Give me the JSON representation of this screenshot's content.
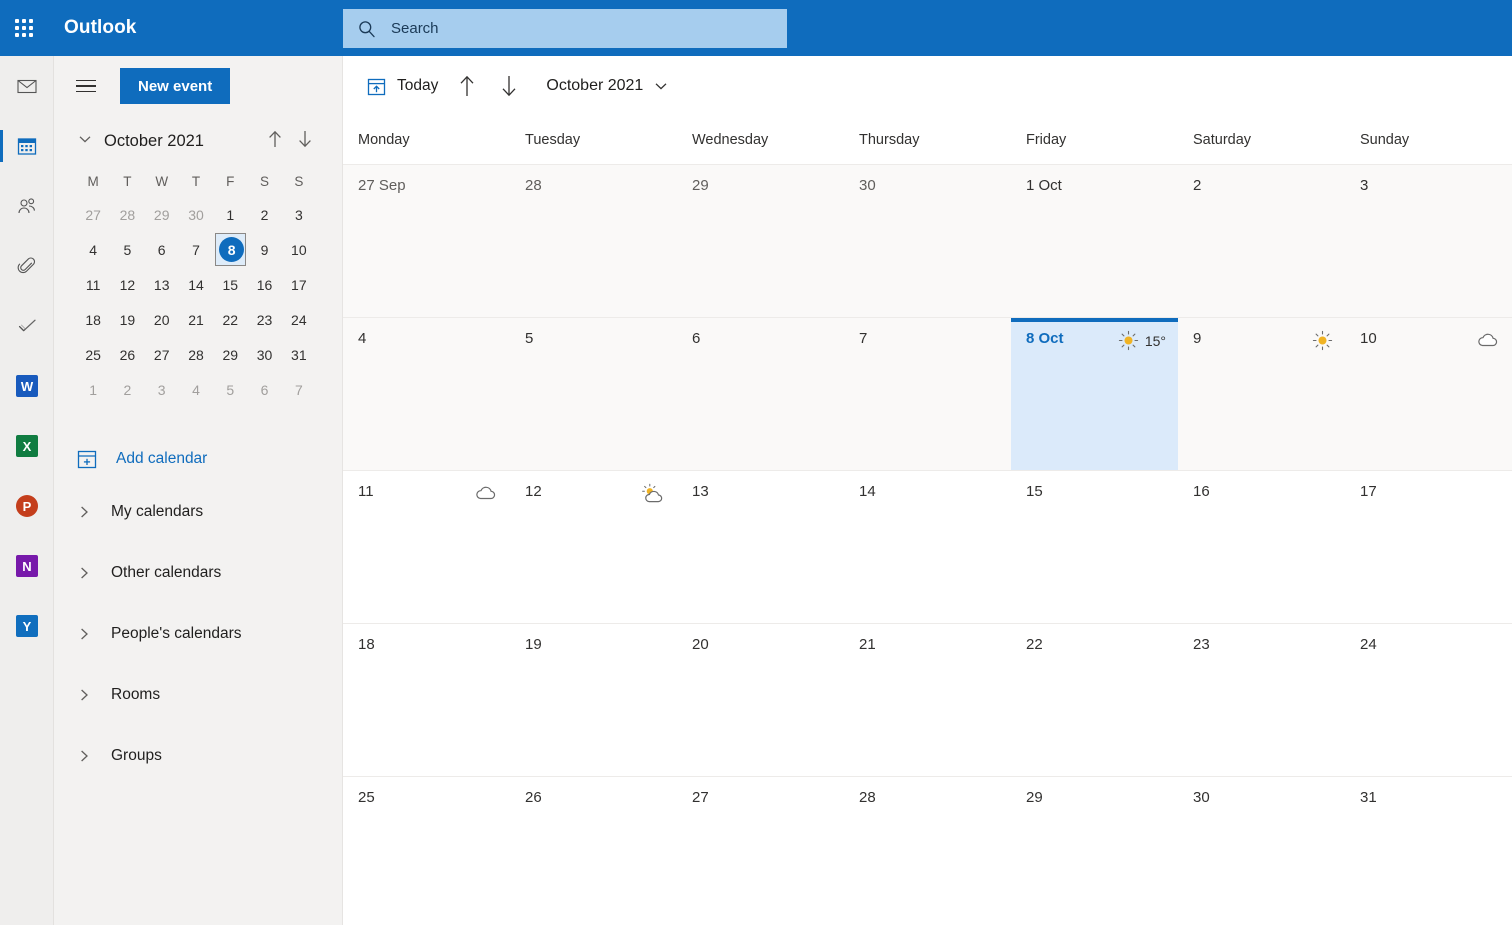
{
  "topbar": {
    "waffle_icon": "app-launcher-icon",
    "brand": "Outlook",
    "search": {
      "icon": "search-icon",
      "placeholder": "Search",
      "value": ""
    }
  },
  "rail": {
    "items": [
      {
        "name": "mail",
        "icon": "mail-icon",
        "label": "Mail",
        "selected": false
      },
      {
        "name": "calendar",
        "icon": "calendar-icon",
        "label": "Calendar",
        "selected": true
      },
      {
        "name": "people",
        "icon": "people-icon",
        "label": "People",
        "selected": false
      },
      {
        "name": "files",
        "icon": "paperclip-icon",
        "label": "Files",
        "selected": false
      },
      {
        "name": "todo",
        "icon": "checkmark-icon",
        "label": "To Do",
        "selected": false
      },
      {
        "name": "word",
        "icon": "word-icon",
        "label": "Word",
        "glyph": "W",
        "color": "#185abd",
        "selected": false
      },
      {
        "name": "excel",
        "icon": "excel-icon",
        "label": "Excel",
        "glyph": "X",
        "color": "#107c41",
        "selected": false
      },
      {
        "name": "powerpoint",
        "icon": "powerpoint-icon",
        "label": "PowerPoint",
        "glyph": "P",
        "color": "#c43e1c",
        "selected": false
      },
      {
        "name": "onenote",
        "icon": "onenote-icon",
        "label": "OneNote",
        "glyph": "N",
        "color": "#7719aa",
        "selected": false
      },
      {
        "name": "yammer",
        "icon": "yammer-icon",
        "label": "Yammer",
        "glyph": "Y",
        "color": "#106ebe",
        "selected": false
      }
    ]
  },
  "leftpane": {
    "hamburger_icon": "hamburger-menu-icon",
    "new_event_label": "New event",
    "minicalendar": {
      "collapse_icon": "chevron-down-icon",
      "title": "October 2021",
      "prev_icon": "arrow-up-icon",
      "next_icon": "arrow-down-icon",
      "weekday_initials": [
        "M",
        "T",
        "W",
        "T",
        "F",
        "S",
        "S"
      ],
      "weeks": [
        [
          {
            "d": "27",
            "other": true
          },
          {
            "d": "28",
            "other": true
          },
          {
            "d": "29",
            "other": true
          },
          {
            "d": "30",
            "other": true
          },
          {
            "d": "1",
            "other": false
          },
          {
            "d": "2",
            "other": false
          },
          {
            "d": "3",
            "other": false
          }
        ],
        [
          {
            "d": "4"
          },
          {
            "d": "5"
          },
          {
            "d": "6"
          },
          {
            "d": "7"
          },
          {
            "d": "8",
            "today": true
          },
          {
            "d": "9"
          },
          {
            "d": "10"
          }
        ],
        [
          {
            "d": "11"
          },
          {
            "d": "12"
          },
          {
            "d": "13"
          },
          {
            "d": "14"
          },
          {
            "d": "15"
          },
          {
            "d": "16"
          },
          {
            "d": "17"
          }
        ],
        [
          {
            "d": "18"
          },
          {
            "d": "19"
          },
          {
            "d": "20"
          },
          {
            "d": "21"
          },
          {
            "d": "22"
          },
          {
            "d": "23"
          },
          {
            "d": "24"
          }
        ],
        [
          {
            "d": "25"
          },
          {
            "d": "26"
          },
          {
            "d": "27"
          },
          {
            "d": "28"
          },
          {
            "d": "29"
          },
          {
            "d": "30"
          },
          {
            "d": "31"
          }
        ],
        [
          {
            "d": "1",
            "other": true
          },
          {
            "d": "2",
            "other": true
          },
          {
            "d": "3",
            "other": true
          },
          {
            "d": "4",
            "other": true
          },
          {
            "d": "5",
            "other": true
          },
          {
            "d": "6",
            "other": true
          },
          {
            "d": "7",
            "other": true
          }
        ]
      ]
    },
    "add_calendar": {
      "icon": "add-calendar-icon",
      "label": "Add calendar"
    },
    "calendar_groups": [
      {
        "name": "my-calendars",
        "label": "My calendars",
        "icon": "chevron-right-icon",
        "expanded": false
      },
      {
        "name": "other-calendars",
        "label": "Other calendars",
        "icon": "chevron-right-icon",
        "expanded": false
      },
      {
        "name": "peoples-calendars",
        "label": "People's calendars",
        "icon": "chevron-right-icon",
        "expanded": false
      },
      {
        "name": "rooms",
        "label": "Rooms",
        "icon": "chevron-right-icon",
        "expanded": false
      },
      {
        "name": "groups",
        "label": "Groups",
        "icon": "chevron-right-icon",
        "expanded": false
      }
    ]
  },
  "calendar": {
    "toolbar": {
      "today_icon": "today-calendar-icon",
      "today_label": "Today",
      "prev_icon": "arrow-up-icon",
      "next_icon": "arrow-down-icon",
      "month_label": "October 2021",
      "month_chevron_icon": "chevron-down-icon"
    },
    "weekday_headers": [
      "Monday",
      "Tuesday",
      "Wednesday",
      "Thursday",
      "Friday",
      "Saturday",
      "Sunday"
    ],
    "weeks": [
      {
        "tinted": true,
        "days": [
          {
            "label": "27 Sep",
            "dim": true
          },
          {
            "label": "28",
            "dim": true
          },
          {
            "label": "29",
            "dim": true
          },
          {
            "label": "30",
            "dim": true
          },
          {
            "label": "1 Oct"
          },
          {
            "label": "2"
          },
          {
            "label": "3"
          }
        ]
      },
      {
        "tinted": true,
        "days": [
          {
            "label": "4"
          },
          {
            "label": "5"
          },
          {
            "label": "6"
          },
          {
            "label": "7"
          },
          {
            "label": "8 Oct",
            "selected": true,
            "weather": "sunny-icon",
            "temp": "15°"
          },
          {
            "label": "9",
            "weather": "sunny-icon"
          },
          {
            "label": "10",
            "weather": "cloudy-icon"
          }
        ]
      },
      {
        "days": [
          {
            "label": "11",
            "weather": "cloudy-icon"
          },
          {
            "label": "12",
            "weather": "partly-cloudy-icon"
          },
          {
            "label": "13"
          },
          {
            "label": "14"
          },
          {
            "label": "15"
          },
          {
            "label": "16"
          },
          {
            "label": "17"
          }
        ]
      },
      {
        "days": [
          {
            "label": "18"
          },
          {
            "label": "19"
          },
          {
            "label": "20"
          },
          {
            "label": "21"
          },
          {
            "label": "22"
          },
          {
            "label": "23"
          },
          {
            "label": "24"
          }
        ]
      },
      {
        "days": [
          {
            "label": "25"
          },
          {
            "label": "26"
          },
          {
            "label": "27"
          },
          {
            "label": "28"
          },
          {
            "label": "29"
          },
          {
            "label": "30"
          },
          {
            "label": "31"
          }
        ]
      }
    ]
  },
  "colors": {
    "brand_blue": "#0f6cbd",
    "topbar_blue": "#0f6cbd",
    "search_bg": "#a6cdee",
    "selected_cell_bg": "#dbeafa",
    "pane_bg": "#f3f2f1",
    "tinted_row": "#faf9f8"
  }
}
